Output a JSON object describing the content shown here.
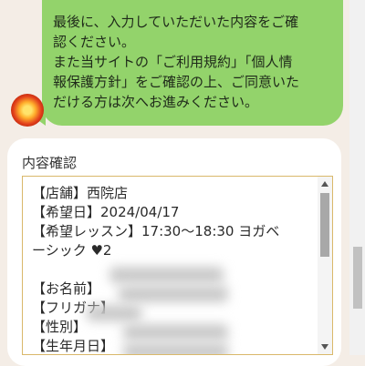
{
  "message": {
    "text": "最後に、入力していただいた内容をご確\n認ください。\nまた当サイトの「ご利用規約」「個人情\n報保護方針」をご確認の上、ご同意いた\nだける方は次へお進みください。"
  },
  "confirmation": {
    "title": "内容確認",
    "content": "【店舗】西院店\n【希望日】2024/04/17\n【希望レッスン】17:30〜18:30 ヨガベ\nーシック ♥2\n\n【お名前】\n【フリガナ】\n【性別】\n【生年月日】\n【電話番号】"
  },
  "colors": {
    "bubble": "#93d36b",
    "page_background": "#f4ede6",
    "textarea_border": "#d9b86a"
  }
}
